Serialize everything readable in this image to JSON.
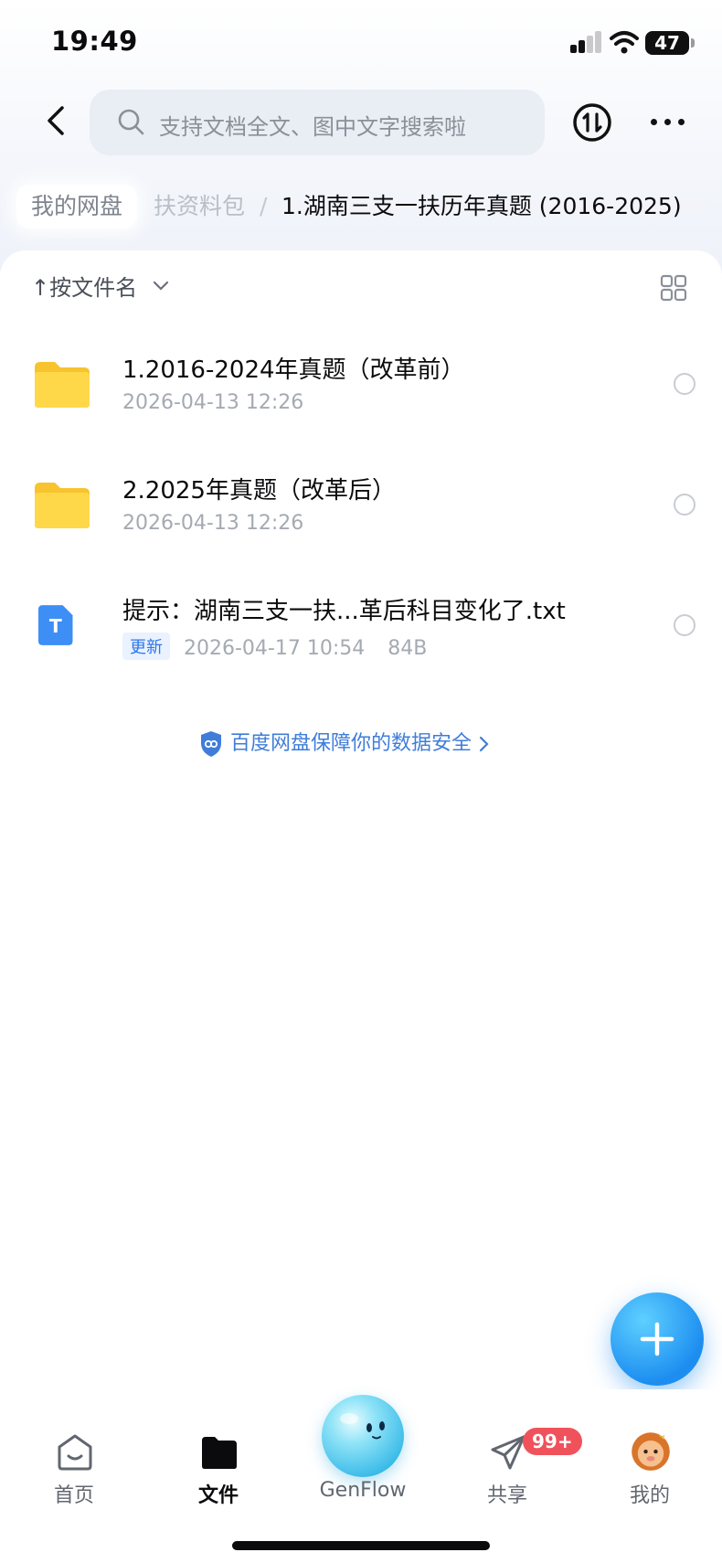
{
  "status_bar": {
    "time": "19:49",
    "battery": "47"
  },
  "header": {
    "search_placeholder": "支持文档全文、图中文字搜索啦"
  },
  "breadcrumb": {
    "root": "我的网盘",
    "middle": "扶资料包",
    "separator": "/",
    "current": "1.湖南三支一扶历年真题 (2016-2025)"
  },
  "toolbar": {
    "sort_label": "↑按文件名"
  },
  "files": [
    {
      "name": "1.2016-2024年真题（改革前）",
      "date": "2026-04-13 12:26",
      "type": "folder"
    },
    {
      "name": "2.2025年真题（改革后）",
      "date": "2026-04-13 12:26",
      "type": "folder"
    },
    {
      "name": "提示：湖南三支一扶...革后科目变化了.txt",
      "tag": "更新",
      "date": "2026-04-17 10:54",
      "size": "84B",
      "type": "txt"
    }
  ],
  "security_notice": "百度网盘保障你的数据安全",
  "tabs": [
    {
      "label": "首页",
      "icon": "home-face-icon"
    },
    {
      "label": "文件",
      "icon": "folder-icon",
      "active": true
    },
    {
      "label": "GenFlow",
      "icon": "genflow-orb-icon"
    },
    {
      "label": "共享",
      "icon": "paper-plane-icon",
      "badge": "99+"
    },
    {
      "label": "我的",
      "icon": "lion-avatar-icon"
    }
  ],
  "colors": {
    "accent": "#2f76e8",
    "folder": "#ffd23f",
    "badge": "#f0525c"
  }
}
